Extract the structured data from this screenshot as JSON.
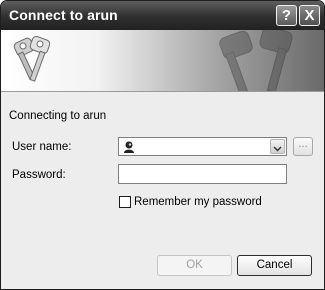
{
  "window": {
    "title": "Connect to arun",
    "help_label": "?",
    "close_label": "X"
  },
  "form": {
    "connecting_text": "Connecting to arun",
    "username_label": "User name:",
    "username_value": "",
    "browse_label": "...",
    "password_label": "Password:",
    "password_value": "",
    "remember_label": "Remember my password",
    "remember_checked": false
  },
  "buttons": {
    "ok_label": "OK",
    "cancel_label": "Cancel"
  }
}
